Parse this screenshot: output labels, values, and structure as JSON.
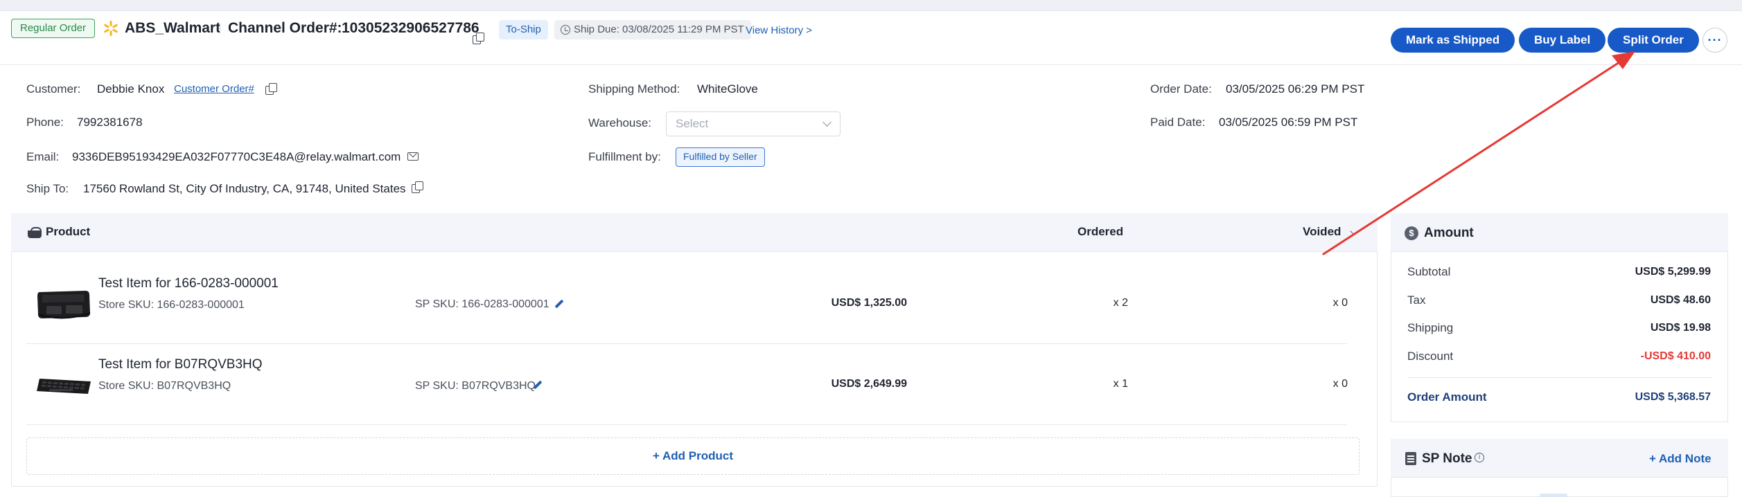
{
  "header": {
    "order_type_badge": "Regular Order",
    "store_name": "ABS_Walmart",
    "channel_order_label": "Channel Order#:",
    "channel_order_number": "10305232906527786",
    "status": "To-Ship",
    "ship_due": "Ship Due: 03/08/2025 11:29 PM PST",
    "view_history": "View History >",
    "buttons": {
      "mark_shipped": "Mark as Shipped",
      "buy_label": "Buy Label",
      "split_order": "Split Order",
      "more": "···"
    }
  },
  "info": {
    "customer_label": "Customer:",
    "customer_name": "Debbie Knox",
    "customer_order_link": "Customer Order#",
    "phone_label": "Phone:",
    "phone": "7992381678",
    "email_label": "Email:",
    "email": "9336DEB95193429EA032F07770C3E48A@relay.walmart.com",
    "ship_to_label": "Ship To:",
    "ship_to": "17560 Rowland St, City Of Industry, CA, 91748, United States",
    "shipping_method_label": "Shipping Method:",
    "shipping_method": "WhiteGlove",
    "warehouse_label": "Warehouse:",
    "warehouse_placeholder": "Select",
    "fulfillment_label": "Fulfillment by:",
    "fulfillment": "Fulfilled by Seller",
    "order_date_label": "Order Date:",
    "order_date": "03/05/2025 06:29 PM PST",
    "paid_date_label": "Paid Date:",
    "paid_date": "03/05/2025 06:59 PM PST"
  },
  "products": {
    "header": {
      "product": "Product",
      "ordered": "Ordered",
      "voided": "Voided"
    },
    "items": [
      {
        "name": "Test Item for 166-0283-000001",
        "store_sku": "Store SKU: 166-0283-000001",
        "sp_sku": "SP SKU: 166-0283-000001",
        "price": "USD$ 1,325.00",
        "ordered": "x 2",
        "voided": "x 0",
        "thumb_icon": "car-trunk-organizer"
      },
      {
        "name": "Test Item for B07RQVB3HQ",
        "store_sku": "Store SKU: B07RQVB3HQ",
        "sp_sku": "SP SKU: B07RQVB3HQ",
        "price": "USD$ 2,649.99",
        "ordered": "x 1",
        "voided": "x 0",
        "thumb_icon": "keyboard"
      }
    ],
    "add_product": "+ Add Product"
  },
  "amount": {
    "title": "Amount",
    "rows": [
      {
        "label": "Subtotal",
        "value": "USD$ 5,299.99"
      },
      {
        "label": "Tax",
        "value": "USD$ 48.60"
      },
      {
        "label": "Shipping",
        "value": "USD$ 19.98"
      },
      {
        "label": "Discount",
        "value": "-USD$ 410.00"
      }
    ],
    "total_label": "Order Amount",
    "total_value": "USD$ 5,368.57"
  },
  "sp_note": {
    "title": "SP Note",
    "add_note": "+ Add Note"
  },
  "colors": {
    "primary": "#1659c7",
    "link": "#1f5fb4",
    "discount": "#e53935",
    "regular_badge": "#3aa35c",
    "annotation_arrow": "#e53935"
  }
}
